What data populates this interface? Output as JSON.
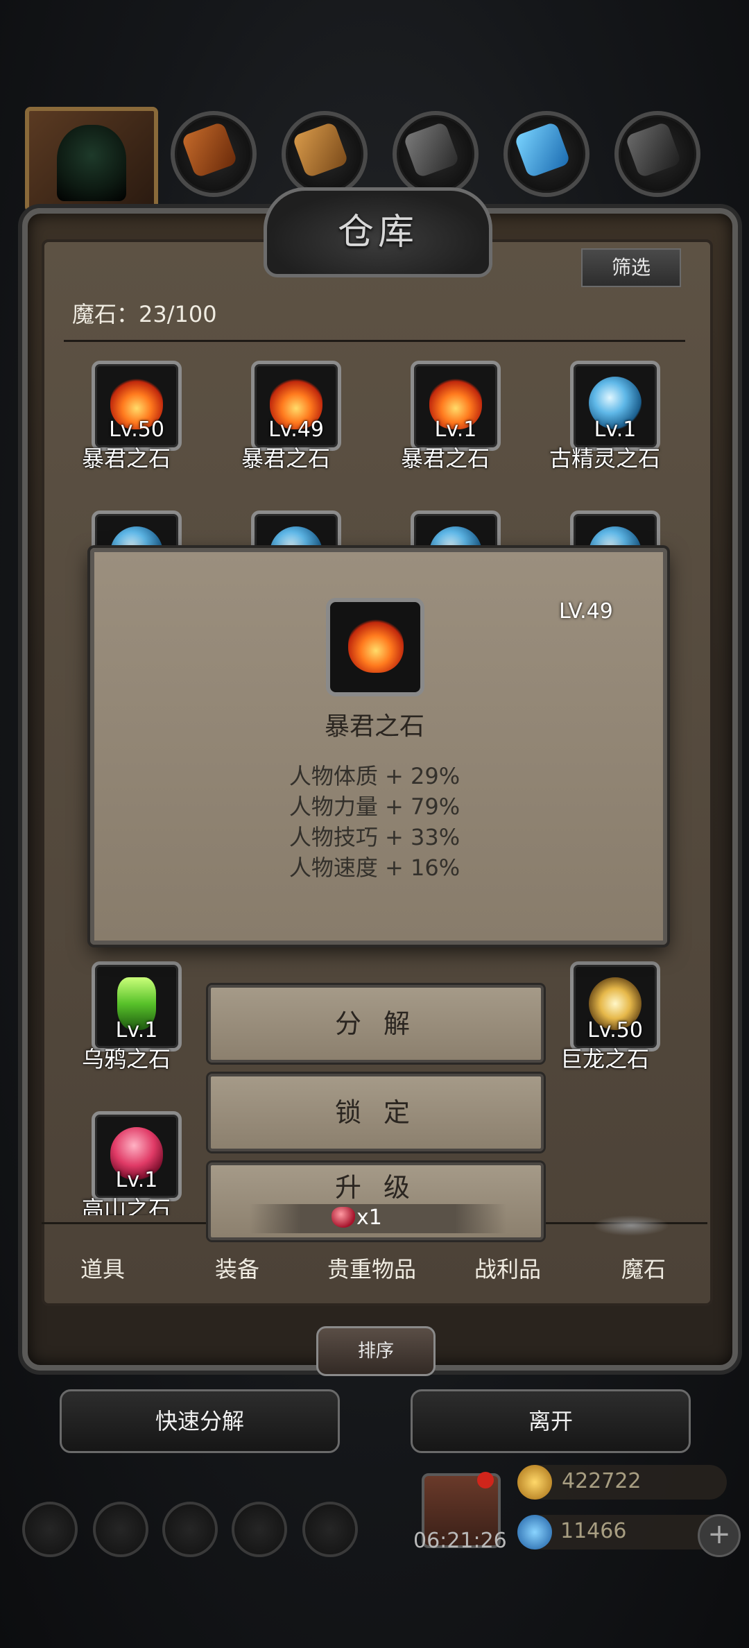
{
  "warehouse": {
    "title": "仓库",
    "filter_label": "筛选",
    "count_label": "魔石：23/100"
  },
  "items": [
    {
      "name": "暴君之石",
      "level": "Lv.50",
      "gem": "fire-gem-icon"
    },
    {
      "name": "暴君之石",
      "level": "Lv.49",
      "gem": "fire-gem-icon"
    },
    {
      "name": "暴君之石",
      "level": "Lv.1",
      "gem": "fire-gem-icon"
    },
    {
      "name": "古精灵之石",
      "level": "Lv.1",
      "gem": "blue-orb-icon"
    },
    {
      "name": "乌鸦之石",
      "level": "Lv.1",
      "gem": "green-crystal-icon"
    },
    {
      "name": "巨龙之石",
      "level": "Lv.50",
      "gem": "gold-dragon-icon"
    },
    {
      "name": "高山之石",
      "level": "Lv.1",
      "gem": "red-gem-icon"
    }
  ],
  "detail": {
    "level": "LV.49",
    "name": "暴君之石",
    "stats": [
      "人物体质 + 29%",
      "人物力量 + 79%",
      "人物技巧 + 33%",
      "人物速度 + 16%"
    ]
  },
  "actions": {
    "decompose": "分 解",
    "lock": "锁 定",
    "upgrade": "升 级",
    "upgrade_cost": "x1"
  },
  "tabs": [
    "道具",
    "装备",
    "贵重物品",
    "战利品",
    "魔石"
  ],
  "active_tab": "魔石",
  "sort_label": "排序",
  "bottom_buttons": {
    "quick_decompose": "快速分解",
    "leave": "离开"
  },
  "timer": "06:21:26",
  "resources": {
    "gold": "422722",
    "gems": "11466"
  },
  "colors": {
    "panel": "#5d5244",
    "dialog": "#9b8f7e",
    "accent": "#d0251b"
  }
}
